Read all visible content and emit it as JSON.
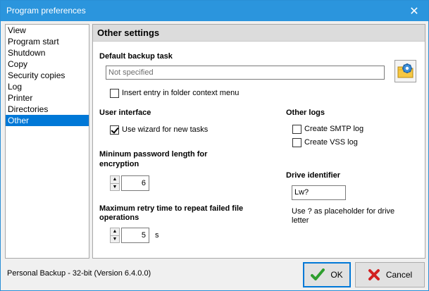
{
  "window": {
    "title": "Program preferences",
    "close_glyph": "✕"
  },
  "nav": {
    "items": [
      {
        "label": "View"
      },
      {
        "label": "Program start"
      },
      {
        "label": "Shutdown"
      },
      {
        "label": "Copy"
      },
      {
        "label": "Security copies"
      },
      {
        "label": "Log"
      },
      {
        "label": "Printer"
      },
      {
        "label": "Directories"
      },
      {
        "label": "Other",
        "selected": true
      }
    ]
  },
  "panel": {
    "title": "Other settings",
    "default_backup": {
      "heading": "Default backup task",
      "value": "Not specified",
      "button_icon": "folder-settings-icon"
    },
    "context_menu_checkbox": {
      "label": "Insert entry in folder context menu",
      "checked": false
    },
    "user_interface": {
      "heading": "User interface",
      "wizard_checkbox": {
        "label": "Use wizard for new tasks",
        "checked": true
      }
    },
    "password": {
      "heading_line1": "Mininum password length for",
      "heading_line2": "encryption",
      "value": "6"
    },
    "retry": {
      "heading_line1": "Maximum retry time to repeat failed file",
      "heading_line2": "operations",
      "value": "5",
      "unit": "s"
    },
    "other_logs": {
      "heading": "Other logs",
      "smtp": {
        "label": "Create SMTP log",
        "checked": false
      },
      "vss": {
        "label": "Create VSS log",
        "checked": false
      }
    },
    "drive": {
      "heading": "Drive identifier",
      "value": "Lw?",
      "hint_line1": "Use ? as placeholder for drive",
      "hint_line2": "letter"
    }
  },
  "footer": {
    "version_text": "Personal Backup - 32-bit (Version 6.4.0.0)",
    "ok_label": "OK",
    "cancel_label": "Cancel"
  },
  "colors": {
    "titlebar": "#2b95dd",
    "selection": "#0078d7",
    "ok_icon": "#2e9e2e",
    "cancel_icon": "#d22020"
  }
}
